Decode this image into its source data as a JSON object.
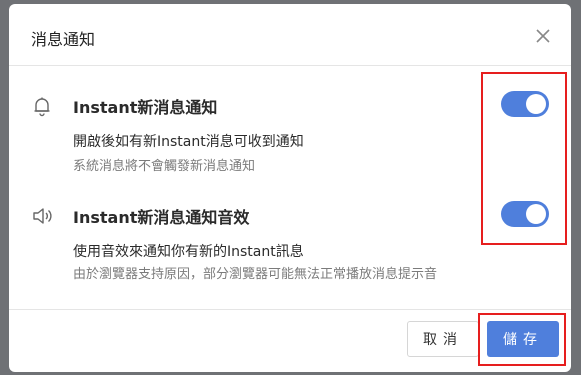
{
  "dialog": {
    "title": "消息通知",
    "close_label": "×"
  },
  "settings": [
    {
      "icon": "bell-icon",
      "title": "Instant新消息通知",
      "description": "開啟後如有新Instant消息可收到通知",
      "hint": "系統消息將不會觸發新消息通知",
      "enabled": true
    },
    {
      "icon": "speaker-icon",
      "title": "Instant新消息通知音效",
      "description": "使用音效來通知你有新的Instant訊息",
      "hint": "由於瀏覽器支持原因，部分瀏覽器可能無法正常播放消息提示音",
      "enabled": true
    }
  ],
  "footer": {
    "cancel_label": "取消",
    "save_label": "儲存"
  },
  "colors": {
    "accent": "#4f7fdc",
    "highlight": "#e61e1e"
  }
}
